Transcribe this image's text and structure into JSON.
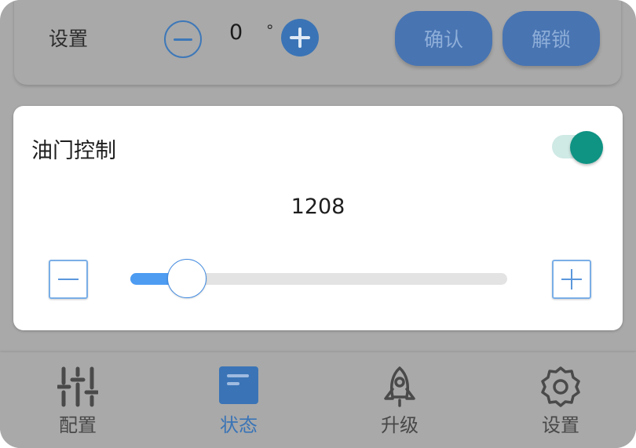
{
  "settings_row": {
    "label": "设置",
    "angle_value": "0",
    "unit": "°",
    "confirm_label": "确认",
    "unlock_label": "解锁"
  },
  "throttle": {
    "title": "油门控制",
    "value": "1208",
    "slider_fraction": 0.13,
    "enabled": true
  },
  "nav": {
    "items": [
      {
        "label": "配置",
        "icon": "sliders-icon",
        "active": false
      },
      {
        "label": "状态",
        "icon": "status-icon",
        "active": true
      },
      {
        "label": "升级",
        "icon": "rocket-icon",
        "active": false
      },
      {
        "label": "设置",
        "icon": "gear-icon",
        "active": false
      }
    ]
  },
  "colors": {
    "accent": "#3a74b6",
    "toggle_on": "#0f9383",
    "slider_fill": "#4d9cf2",
    "overlay_gray": "#a9a9a9"
  }
}
